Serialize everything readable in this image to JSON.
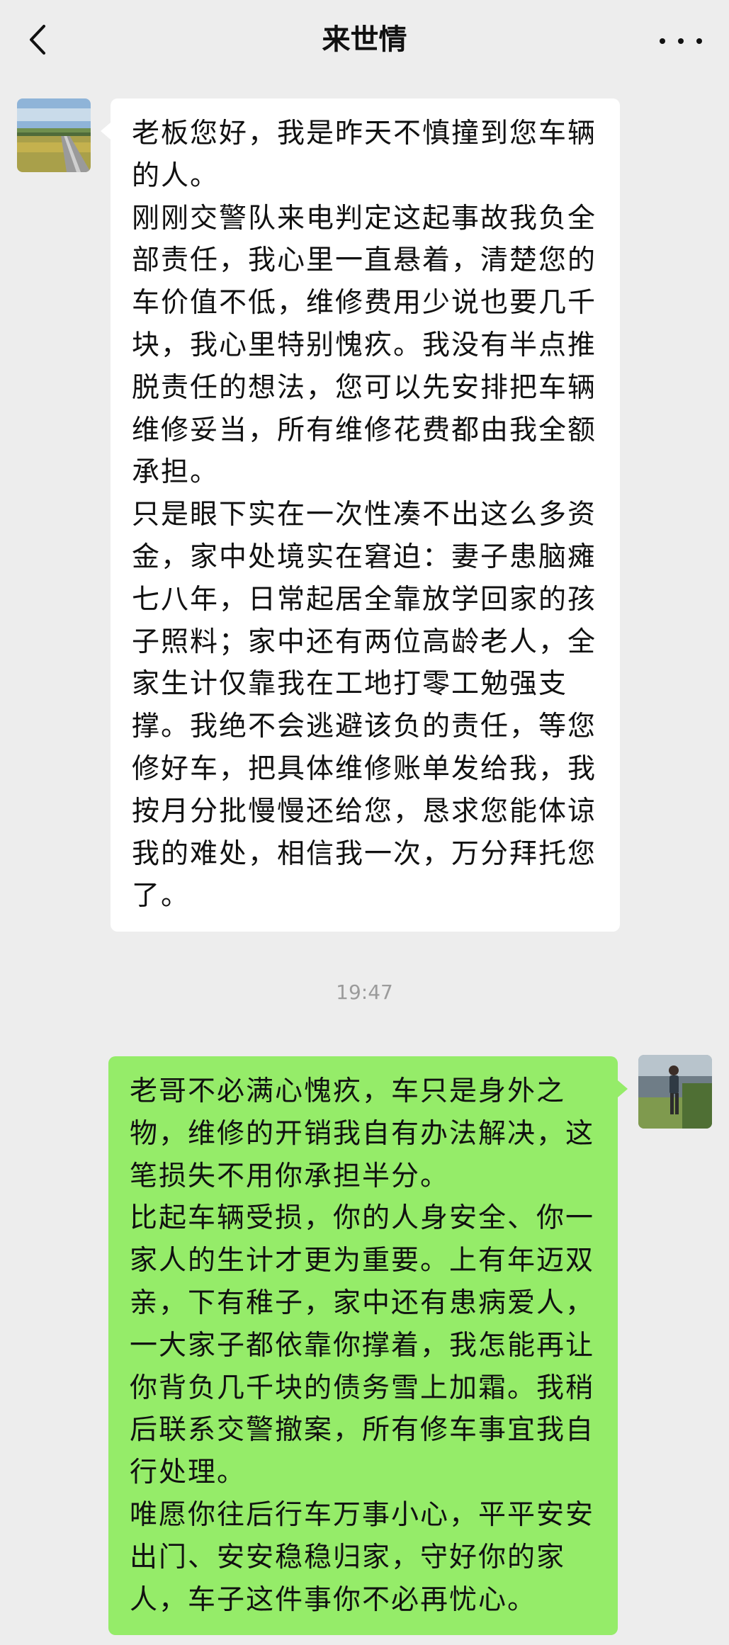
{
  "header": {
    "title": "来世情",
    "back_icon": "chevron-left-icon",
    "more_icon": "ellipsis-icon"
  },
  "colors": {
    "background": "#ededed",
    "incoming_bubble": "#ffffff",
    "outgoing_bubble": "#95ec69"
  },
  "messages": [
    {
      "direction": "incoming",
      "paragraphs": [
        "老板您好，我是昨天不慎撞到您车辆的人。",
        "刚刚交警队来电判定这起事故我负全部责任，我心里一直悬着，清楚您的车价值不低，维修费用少说也要几千块，我心里特别愧疚。我没有半点推脱责任的想法，您可以先安排把车辆维修妥当，所有维修花费都由我全额承担。",
        "只是眼下实在一次性凑不出这么多资金，家中处境实在窘迫：妻子患脑瘫七八年，日常起居全靠放学回家的孩子照料；家中还有两位高龄老人，全家生计仅靠我在工地打零工勉强支撑。我绝不会逃避该负的责任，等您修好车，把具体维修账单发给我，我按月分批慢慢还给您，恳求您能体谅我的难处，相信我一次，万分拜托您了。"
      ]
    },
    {
      "timestamp": "19:47"
    },
    {
      "direction": "outgoing",
      "paragraphs": [
        "老哥不必满心愧疚，车只是身外之物，维修的开销我自有办法解决，这笔损失不用你承担半分。",
        "比起车辆受损，你的人身安全、你一家人的生计才更为重要。上有年迈双亲，下有稚子，家中还有患病爱人，一大家子都依靠你撑着，我怎能再让你背负几千块的债务雪上加霜。我稍后联系交警撤案，所有修车事宜我自行处理。",
        "唯愿你往后行车万事小心，平平安安出门、安安稳稳归家，守好你的家人，车子这件事你不必再忧心。"
      ]
    }
  ]
}
